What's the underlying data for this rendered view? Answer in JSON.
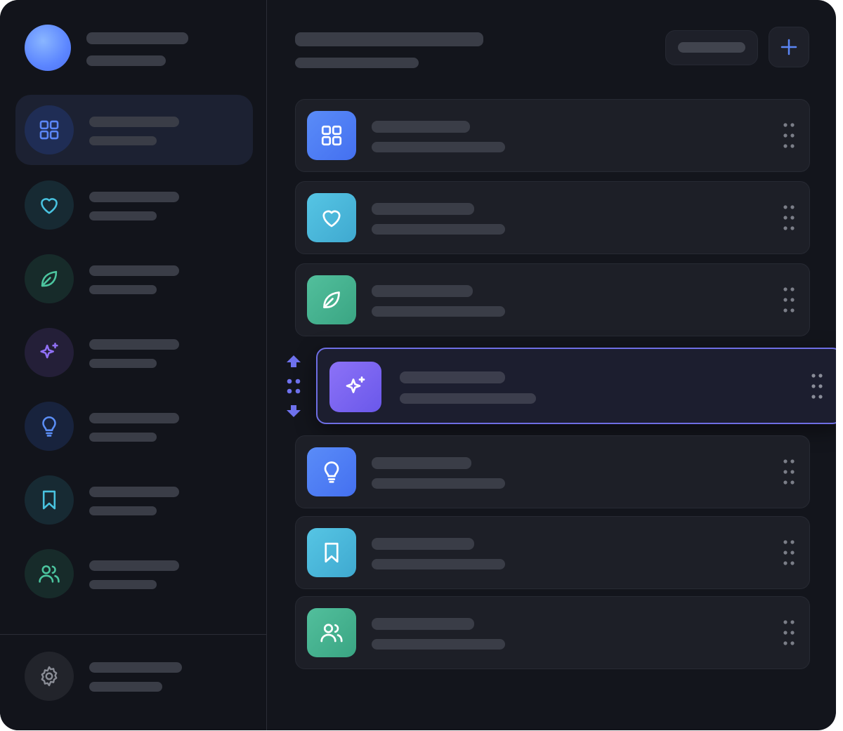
{
  "colors": {
    "window_bg": "#13151c",
    "sidebar_bg": "#12141b",
    "card_bg": "#1d1f27",
    "placeholder_bar": "#3a3d47",
    "accent_blue": "#4f7cf5",
    "accent_cyan": "#49b8d9",
    "accent_green": "#42ad8f",
    "accent_purple": "#7c64f2",
    "drag_border": "#6e6ee3"
  },
  "sidebar": {
    "avatar": {
      "icon": "avatar"
    },
    "items": [
      {
        "icon": "grid-icon",
        "active": true
      },
      {
        "icon": "heart-icon",
        "active": false
      },
      {
        "icon": "leaf-icon",
        "active": false
      },
      {
        "icon": "sparkle-icon",
        "active": false
      },
      {
        "icon": "lightbulb-icon",
        "active": false
      },
      {
        "icon": "bookmark-icon",
        "active": false
      },
      {
        "icon": "users-icon",
        "active": false
      }
    ],
    "footer": {
      "icon": "gear-icon"
    }
  },
  "header": {
    "add_button": {
      "icon": "plus-icon"
    }
  },
  "list": {
    "cards": [
      {
        "icon": "grid-icon",
        "color": "#4f7cf5"
      },
      {
        "icon": "heart-icon",
        "color": "#49b8d9"
      },
      {
        "icon": "leaf-icon",
        "color": "#42ad8f"
      },
      {
        "icon": "sparkle-icon",
        "color": "#7c64f2",
        "dragging": true
      },
      {
        "icon": "lightbulb-icon",
        "color": "#4f7cf5"
      },
      {
        "icon": "bookmark-icon",
        "color": "#49b8d9"
      },
      {
        "icon": "users-icon",
        "color": "#42ad8f"
      }
    ]
  }
}
